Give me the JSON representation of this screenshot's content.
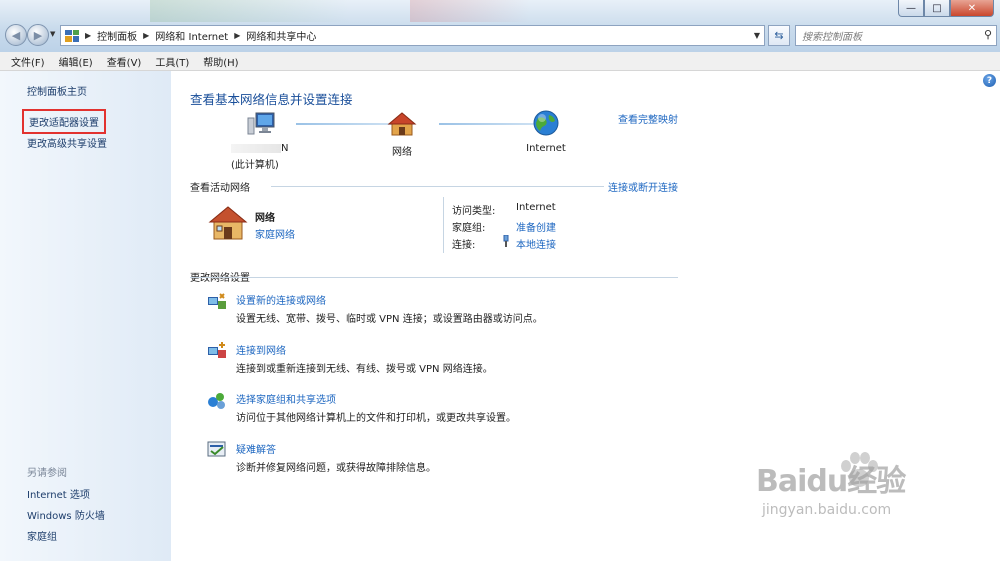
{
  "window": {
    "minimize_glyph": "—",
    "maximize_glyph": "□",
    "close_glyph": "✕"
  },
  "address_bar": {
    "crumbs": [
      "控制面板",
      "网络和 Internet",
      "网络和共享中心"
    ],
    "search_placeholder": "搜索控制面板"
  },
  "menu": [
    "文件(F)",
    "编辑(E)",
    "查看(V)",
    "工具(T)",
    "帮助(H)"
  ],
  "sidebar": {
    "links": [
      "控制面板主页",
      "更改适配器设置",
      "更改高级共享设置"
    ],
    "see_also_heading": "另请参阅",
    "see_also": [
      "Internet 选项",
      "Windows 防火墙",
      "家庭组"
    ]
  },
  "main": {
    "title": "查看基本网络信息并设置连接",
    "full_map_link": "查看完整映射",
    "map": {
      "computer_name": "N",
      "computer_sub": "(此计算机)",
      "network": "网络",
      "internet": "Internet"
    },
    "active_networks": {
      "heading": "查看活动网络",
      "connect_link": "连接或断开连接",
      "network_name": "网络",
      "network_type": "家庭网络",
      "access_type_label": "访问类型:",
      "access_type_value": "Internet",
      "homegroup_label": "家庭组:",
      "homegroup_value": "准备创建",
      "connections_label": "连接:",
      "connections_value": "本地连接"
    },
    "change_settings": {
      "heading": "更改网络设置",
      "tasks": [
        {
          "title": "设置新的连接或网络",
          "desc": "设置无线、宽带、拨号、临时或 VPN 连接；或设置路由器或访问点。"
        },
        {
          "title": "连接到网络",
          "desc": "连接到或重新连接到无线、有线、拨号或 VPN 网络连接。"
        },
        {
          "title": "选择家庭组和共享选项",
          "desc": "访问位于其他网络计算机上的文件和打印机，或更改共享设置。"
        },
        {
          "title": "疑难解答",
          "desc": "诊断并修复网络问题，或获得故障排除信息。"
        }
      ]
    }
  },
  "watermark": {
    "brand": "Baidu经验",
    "url": "jingyan.baidu.com"
  },
  "colors": {
    "link": "#1c66c0",
    "title": "#1a4f9a",
    "highlight_box": "#e2322f"
  }
}
